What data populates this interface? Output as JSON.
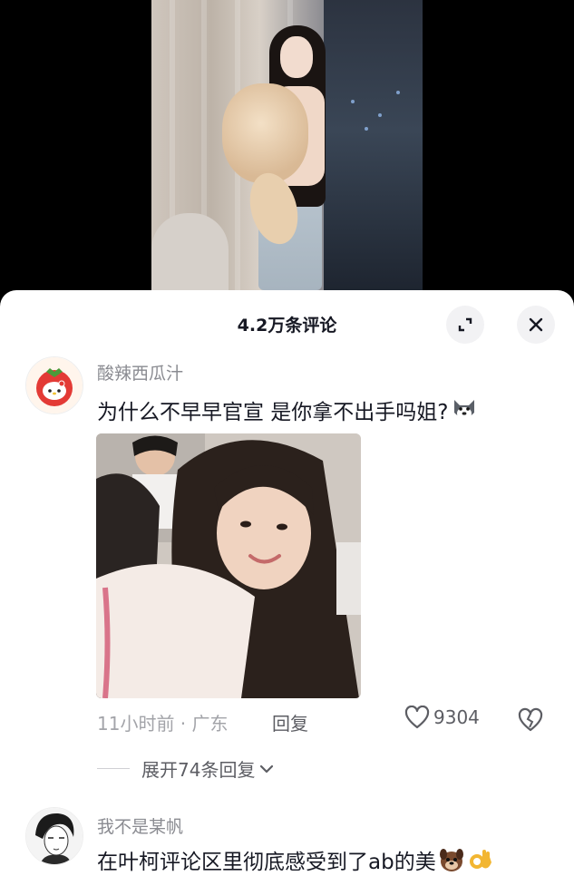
{
  "sheet": {
    "title": "4.2万条评论",
    "expand_icon": "expand-icon",
    "close_icon": "close-icon"
  },
  "comments": [
    {
      "username": "酸辣西瓜汁",
      "text": "为什么不早早官宣 是你拿不出手吗姐?",
      "emoji": "husky-emoji",
      "time": "11小时前 · 广东",
      "reply_label": "回复",
      "likes": "9304",
      "replies_label": "展开74条回复"
    },
    {
      "username": "我不是某帆",
      "text": "在叶柯评论区里彻底感受到了ab的美",
      "emojis": [
        "dog-face-emoji",
        "ok-hand-emoji"
      ]
    }
  ],
  "colors": {
    "text_primary": "#161823",
    "text_secondary": "#8a8b91",
    "sheet_bg": "#ffffff",
    "button_bg": "#f2f2f4"
  }
}
